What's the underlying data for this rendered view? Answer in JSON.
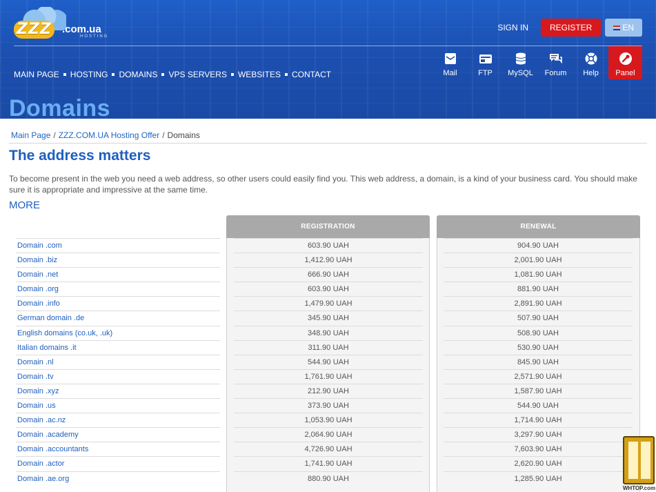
{
  "header": {
    "logo": {
      "main": "ZZZ",
      "tld": ".com.ua",
      "sub": "HOSTING"
    },
    "signin": "SIGN IN",
    "register": "REGISTER",
    "language": "EN",
    "nav": [
      "MAIN PAGE",
      "HOSTING",
      "DOMAINS",
      "VPS SERVERS",
      "WEBSITES",
      "CONTACT"
    ],
    "tools": [
      {
        "label": "Mail",
        "icon": "mail-icon"
      },
      {
        "label": "FTP",
        "icon": "ftp-icon"
      },
      {
        "label": "MySQL",
        "icon": "database-icon"
      },
      {
        "label": "Forum",
        "icon": "forum-icon"
      },
      {
        "label": "Help",
        "icon": "help-icon"
      },
      {
        "label": "Panel",
        "icon": "panel-icon"
      }
    ],
    "page_heading": "Domains",
    "accent": "#d7191d"
  },
  "breadcrumb": [
    "Main Page",
    "ZZZ.COM.UA Hosting Offer",
    "Domains"
  ],
  "section": {
    "title": "The address matters",
    "intro": "To become present in the web you need a web address, so other users could easily find you. This web address, a domain, is a kind of your business card. You should make sure it is appropriate and impressive at the same time.",
    "more": "MORE"
  },
  "table": {
    "registration_header": "REGISTRATION",
    "renewal_header": "RENEWAL",
    "rows": [
      {
        "name": "Domain .com",
        "registration": "603.90 UAH",
        "renewal": "904.90 UAH"
      },
      {
        "name": "Domain .biz",
        "registration": "1,412.90 UAH",
        "renewal": "2,001.90 UAH"
      },
      {
        "name": "Domain .net",
        "registration": "666.90 UAH",
        "renewal": "1,081.90 UAH"
      },
      {
        "name": "Domain .org",
        "registration": "603.90 UAH",
        "renewal": "881.90 UAH"
      },
      {
        "name": "Domain .info",
        "registration": "1,479.90 UAH",
        "renewal": "2,891.90 UAH"
      },
      {
        "name": "German domain .de",
        "registration": "345.90 UAH",
        "renewal": "507.90 UAH"
      },
      {
        "name": "English domains (co.uk, .uk)",
        "registration": "348.90 UAH",
        "renewal": "508.90 UAH"
      },
      {
        "name": "Italian domains .it",
        "registration": "311.90 UAH",
        "renewal": "530.90 UAH"
      },
      {
        "name": "Domain .nl",
        "registration": "544.90 UAH",
        "renewal": "845.90 UAH"
      },
      {
        "name": "Domain .tv",
        "registration": "1,761.90 UAH",
        "renewal": "2,571.90 UAH"
      },
      {
        "name": "Domain .xyz",
        "registration": "212.90 UAH",
        "renewal": "1,587.90 UAH"
      },
      {
        "name": "Domain .us",
        "registration": "373.90 UAH",
        "renewal": "544.90 UAH"
      },
      {
        "name": "Domain .ac.nz",
        "registration": "1,053.90 UAH",
        "renewal": "1,714.90 UAH"
      },
      {
        "name": "Domain .academy",
        "registration": "2,064.90 UAH",
        "renewal": "3,297.90 UAH"
      },
      {
        "name": "Domain .accountants",
        "registration": "4,726.90 UAH",
        "renewal": "7,603.90 UAH"
      },
      {
        "name": "Domain .actor",
        "registration": "1,741.90 UAH",
        "renewal": "2,620.90 UAH"
      },
      {
        "name": "Domain .ae.org",
        "registration": "880.90 UAH",
        "renewal": "1,285.90 UAH"
      }
    ]
  },
  "watermark": "WHTOP.com"
}
